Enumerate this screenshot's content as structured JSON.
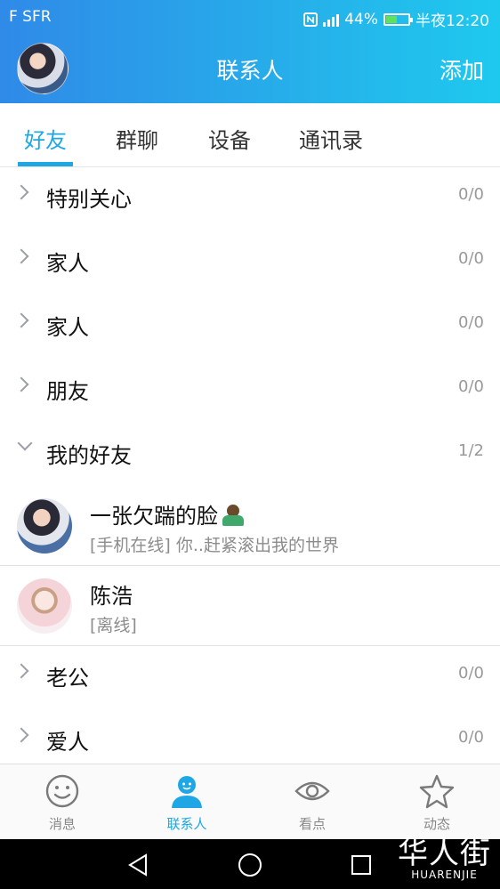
{
  "status_bar": {
    "carrier": "F SFR",
    "battery": "44%",
    "time": "半夜12:20"
  },
  "header": {
    "title": "联系人",
    "add_label": "添加"
  },
  "tabs": [
    {
      "label": "好友",
      "active": true
    },
    {
      "label": "群聊",
      "active": false
    },
    {
      "label": "设备",
      "active": false
    },
    {
      "label": "通讯录",
      "active": false
    }
  ],
  "groups": [
    {
      "name": "特别关心",
      "count": "0/0",
      "expanded": false
    },
    {
      "name": "家人",
      "count": "0/0",
      "expanded": false
    },
    {
      "name": "家人",
      "count": "0/0",
      "expanded": false
    },
    {
      "name": "朋友",
      "count": "0/0",
      "expanded": false
    },
    {
      "name": "我的好友",
      "count": "1/2",
      "expanded": true
    },
    {
      "name": "老公",
      "count": "0/0",
      "expanded": false
    },
    {
      "name": "爱人",
      "count": "0/0",
      "expanded": false
    }
  ],
  "friends": [
    {
      "name": "一张欠踹的脸",
      "status": "[手机在线] 你..赶紧滚出我的世界"
    },
    {
      "name": "陈浩",
      "status": "[离线]"
    }
  ],
  "bottom_nav": [
    {
      "label": "消息",
      "icon": "smiley-icon",
      "active": false
    },
    {
      "label": "联系人",
      "icon": "contact-person-icon",
      "active": true
    },
    {
      "label": "看点",
      "icon": "eye-icon",
      "active": false
    },
    {
      "label": "动态",
      "icon": "star-icon",
      "active": false
    }
  ],
  "watermark": {
    "text_cn": "华人街",
    "text_en": "HUARENJIE"
  },
  "colors": {
    "accent": "#1ea7e4",
    "header_gradient_start": "#2f8ae8",
    "header_gradient_end": "#1ec9ee"
  }
}
